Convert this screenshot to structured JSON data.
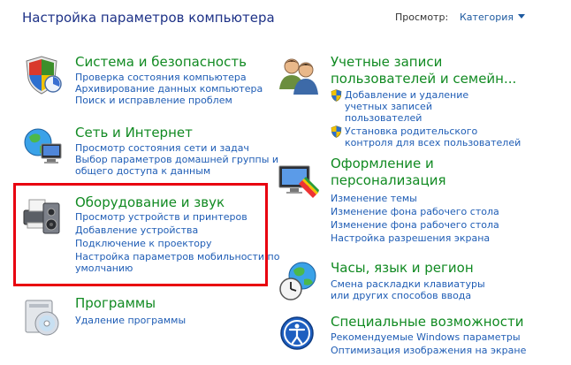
{
  "header": {
    "title": "Настройка параметров компьютера",
    "view_by_label": "Просмотр:",
    "view_by_value": "Категория"
  },
  "categories": {
    "system": {
      "title": "Система и безопасность",
      "icon": "shield-security-icon",
      "links": [
        "Проверка состояния компьютера",
        "Архивирование данных компьютера",
        "Поиск и исправление проблем"
      ]
    },
    "network": {
      "title": "Сеть и Интернет",
      "icon": "globe-network-icon",
      "links": [
        "Просмотр состояния сети и задач",
        "Выбор параметров домашней группы и общего доступа к данным"
      ]
    },
    "hardware": {
      "title": "Оборудование и звук",
      "icon": "printer-speaker-icon",
      "links": [
        "Просмотр устройств и принтеров",
        "Добавление устройства",
        "Подключение к проектору",
        "Настройка параметров мобильности по умолчанию"
      ]
    },
    "programs": {
      "title": "Программы",
      "icon": "programs-disc-icon",
      "links": [
        "Удаление программы"
      ]
    },
    "users": {
      "title_line1": "Учетные записи",
      "title_line2": "пользователей и семейн...",
      "icon": "users-icon",
      "links": [
        "Добавление и удаление учетных записей пользователей",
        "Установка родительского контроля для всех пользователей"
      ]
    },
    "appearance": {
      "title_line1": "Оформление и",
      "title_line2": "персонализация",
      "icon": "monitor-palette-icon",
      "links": [
        "Изменение темы",
        "Изменение фона рабочего стола",
        "Изменение фона рабочего стола",
        "Настройка разрешения экрана"
      ]
    },
    "clock": {
      "title": "Часы, язык и регион",
      "icon": "clock-globe-icon",
      "links": [
        "Смена раскладки клавиатуры или других способов ввода"
      ]
    },
    "ease": {
      "title": "Специальные возможности",
      "icon": "accessibility-icon",
      "links": [
        "Рекомендуемые Windows параметры",
        "Оптимизация изображения на экране"
      ]
    }
  },
  "colors": {
    "title": "#1e3287",
    "category": "#118a22",
    "link": "#1f5db5",
    "highlight": "#e8000f"
  }
}
